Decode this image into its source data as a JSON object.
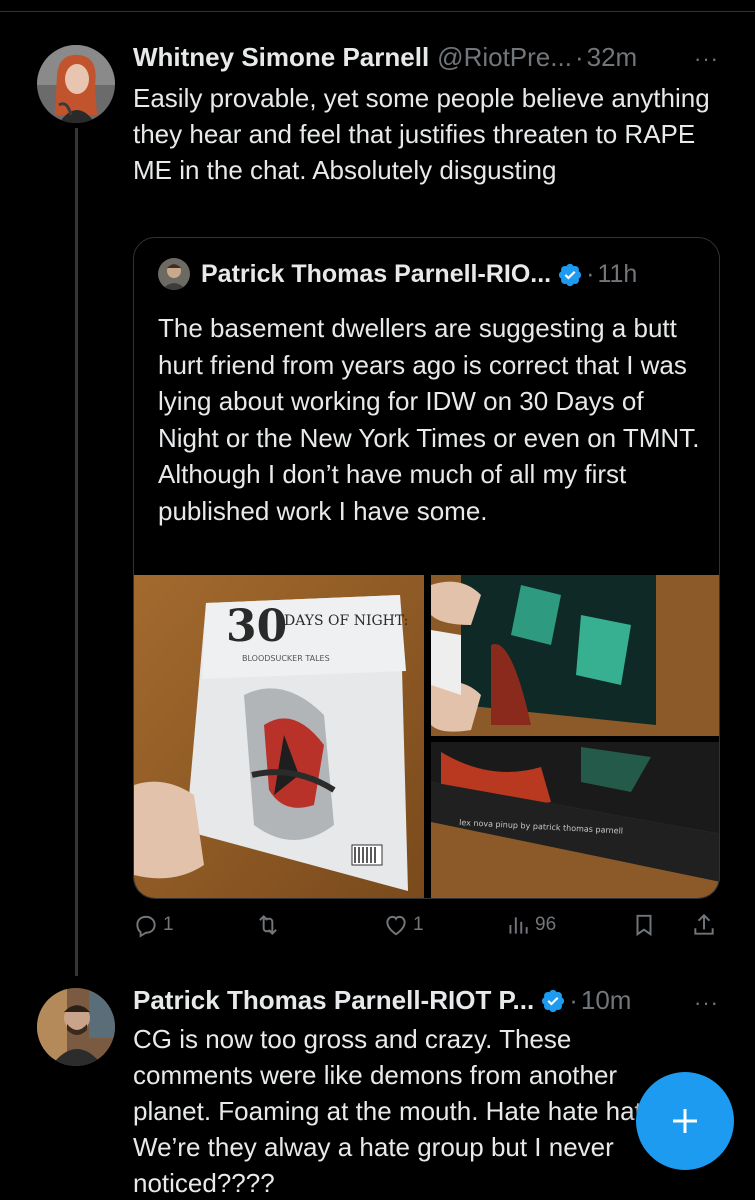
{
  "post1": {
    "name": "Whitney Simone Parnell",
    "handle": "@RiotPre...",
    "dot": "·",
    "time": "32m",
    "more": "···",
    "text": "Easily provable, yet some people believe anything they hear and feel that justifies threaten to RAPE ME in the chat. Absolutely disgusting",
    "quote": {
      "name": "Patrick Thomas Parnell-RIO...",
      "dot": "·",
      "time": "11h",
      "text": "The basement dwellers are suggesting a butt hurt friend from years ago is correct that I was lying about working for IDW on 30 Days of Night or the New York Times or even on TMNT. Although I don’t have much of all my first published work I have some.",
      "comic_title_big": "30",
      "comic_title_small": "DAYS OF NIGHT:",
      "comic_subtitle": "BLOODSUCKER TALES",
      "pinup_caption": "lex nova pinup by patrick thomas parnell"
    },
    "actions": {
      "replies": "1",
      "reposts": "",
      "likes": "1",
      "views": "96"
    }
  },
  "post2": {
    "name": "Patrick Thomas Parnell-RIOT P...",
    "dot": "·",
    "time": "10m",
    "more": "···",
    "text": "CG is now too gross and crazy.  These comments were like demons from another planet. Foaming at the mouth. Hate hate hate. We’re they alway a hate group but I never noticed????"
  },
  "colors": {
    "background": "#000000",
    "text": "#e7e9ea",
    "muted": "#71767b",
    "accent": "#1d9bf0",
    "border": "#2f3336"
  },
  "icons": [
    "reply-icon",
    "repost-icon",
    "like-icon",
    "views-icon",
    "bookmark-icon",
    "share-icon",
    "verified-badge-icon",
    "compose-plus-icon"
  ]
}
